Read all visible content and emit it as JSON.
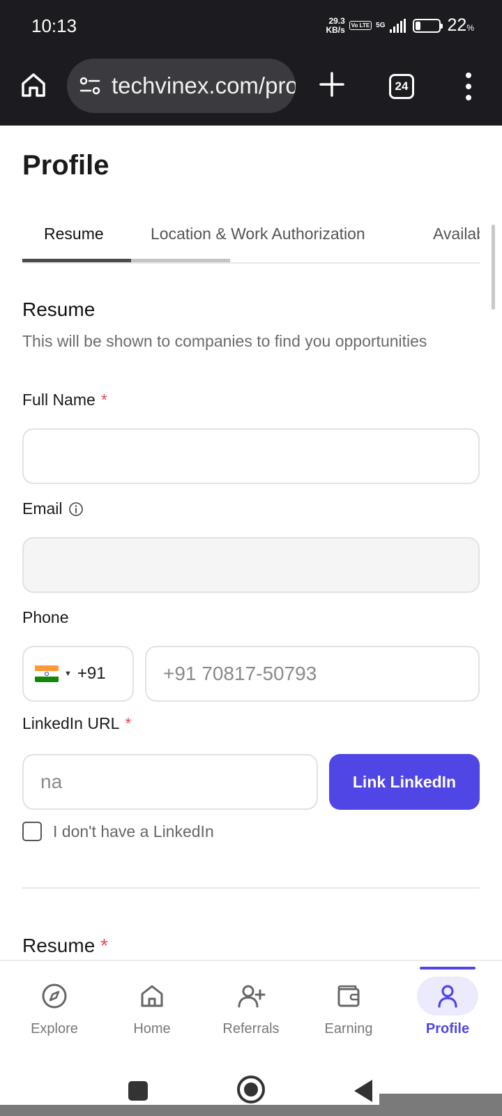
{
  "status_bar": {
    "time": "10:13",
    "speed_value": "29.3",
    "speed_unit": "KB/s",
    "volte": "Vo LTE",
    "network": "5G",
    "battery_percent": "22",
    "battery_unit": "%"
  },
  "browser": {
    "url": "techvinex.com/profile",
    "tab_count": "24",
    "icons": [
      "home-icon",
      "site-settings-icon",
      "plus-icon",
      "tab-switcher-icon",
      "more-vert-icon"
    ]
  },
  "page": {
    "title": "Profile",
    "tabs": [
      {
        "label": "Resume",
        "active": true
      },
      {
        "label": "Location & Work Authorization",
        "active": false
      },
      {
        "label": "Availability",
        "active": false
      }
    ],
    "section": {
      "title": "Resume",
      "description": "This will be shown to companies to find you opportunities"
    },
    "form": {
      "full_name": {
        "label": "Full Name",
        "required_mark": "*",
        "value": ""
      },
      "email": {
        "label": "Email",
        "value": ""
      },
      "phone": {
        "label": "Phone",
        "country_code": "+91",
        "country": "India",
        "placeholder": "+91 70817-50793"
      },
      "linkedin": {
        "label": "LinkedIn URL",
        "required_mark": "*",
        "value": "na",
        "button": "Link LinkedIn"
      },
      "no_linkedin_checkbox": {
        "label": "I don't have a LinkedIn",
        "checked": false
      },
      "resume_section": {
        "label": "Resume",
        "required_mark": "*"
      }
    }
  },
  "bottom_nav": {
    "items": [
      {
        "label": "Explore",
        "icon": "compass-icon",
        "active": false
      },
      {
        "label": "Home",
        "icon": "home-icon",
        "active": false
      },
      {
        "label": "Referrals",
        "icon": "user-plus-icon",
        "active": false
      },
      {
        "label": "Earning",
        "icon": "wallet-icon",
        "active": false
      },
      {
        "label": "Profile",
        "icon": "user-icon",
        "active": true
      }
    ]
  },
  "colors": {
    "accent": "#4f46e5",
    "required": "#e5484d",
    "chrome_bg": "#1c1b1f"
  }
}
